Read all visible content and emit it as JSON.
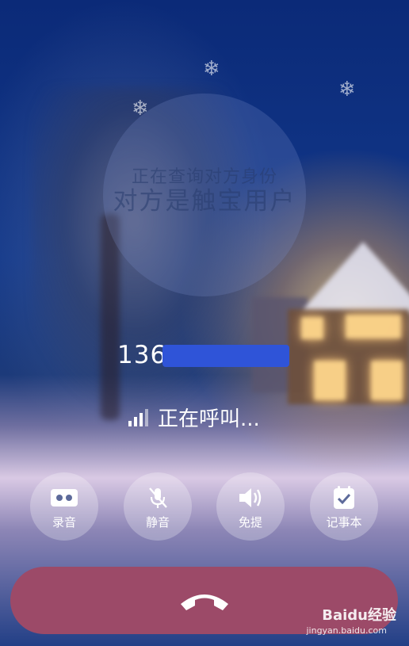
{
  "caller": {
    "query_status": "正在查询对方身份",
    "user_type": "对方是触宝用户",
    "number_visible": "136"
  },
  "call_status": "正在呼叫...",
  "actions": [
    {
      "label": "录音",
      "icon": "record-icon"
    },
    {
      "label": "静音",
      "icon": "mute-icon"
    },
    {
      "label": "免提",
      "icon": "speaker-icon"
    },
    {
      "label": "记事本",
      "icon": "notepad-icon"
    }
  ],
  "hangup": {
    "icon": "hangup-icon",
    "color": "#9c4a68"
  },
  "watermark": {
    "brand": "Baidu经验",
    "url": "jingyan.baidu.com"
  }
}
